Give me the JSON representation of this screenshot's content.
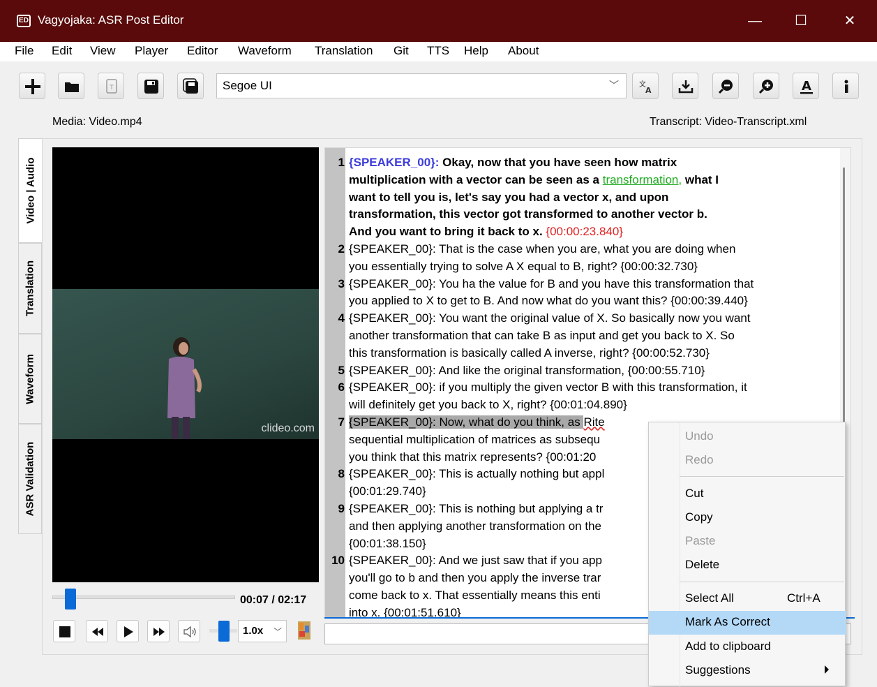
{
  "window": {
    "title": "Vagyojaka: ASR Post Editor",
    "app_icon_text": "ED"
  },
  "menu": [
    "File",
    "Edit",
    "View",
    "Player",
    "Editor",
    "Waveform",
    "Translation",
    "Git",
    "TTS",
    "Help",
    "About"
  ],
  "toolbar": {
    "font": "Segoe UI"
  },
  "labels": {
    "media": "Media: Video.mp4",
    "transcript": "Transcript: Video-Transcript.xml"
  },
  "tabs": [
    "Video | Audio",
    "Translation",
    "Waveform",
    "ASR Validation"
  ],
  "video": {
    "watermark": "clideo.com"
  },
  "player": {
    "time": "00:07 / 02:17",
    "speed": "1.0x",
    "position": 0.05,
    "volume": 0.9
  },
  "transcript": [
    {
      "num": "1",
      "lines": [
        {
          "speaker": "{SPEAKER_00}:",
          "text": " Okay, now that you have seen how matrix"
        },
        {
          "text": "multiplication with a vector can be seen as a ",
          "highlight": "transformation,",
          "after": " what I"
        },
        {
          "text": "want to tell you is, let's say you had a vector x, and upon"
        },
        {
          "text": "transformation, this vector got transformed to another vector b."
        },
        {
          "text": "And you want to bring it back to x. ",
          "ts": "{00:00:23.840}"
        }
      ]
    },
    {
      "num": "2",
      "lines": [
        {
          "text": "{SPEAKER_00}: That is the case when you are, what you are doing when"
        },
        {
          "text": "you essentially trying to solve A X equal to B, right? {00:00:32.730}"
        }
      ]
    },
    {
      "num": "3",
      "lines": [
        {
          "text": "{SPEAKER_00}: You ha the value for B and you have this transformation that"
        },
        {
          "text": "you applied to X to get to B. And now what do you want this? {00:00:39.440}"
        }
      ]
    },
    {
      "num": "4",
      "lines": [
        {
          "text": "{SPEAKER_00}: You want the original value of X. So basically now you want"
        },
        {
          "text": "another transformation that can take B as input and get you back to X. So"
        },
        {
          "text": "this transformation is basically called A inverse, right? {00:00:52.730}"
        }
      ]
    },
    {
      "num": "5",
      "lines": [
        {
          "text": "{SPEAKER_00}: And like the original transformation, {00:00:55.710}"
        }
      ]
    },
    {
      "num": "6",
      "lines": [
        {
          "text": "{SPEAKER_00}: if you multiply the given vector B with this transformation, it"
        },
        {
          "text": "will definitely get you back to X, right? {00:01:04.890}"
        }
      ]
    },
    {
      "num": "7",
      "lines": [
        {
          "sel": "{SPEAKER_00}: Now, what do you think, as ",
          "squiggle": "Rite"
        },
        {
          "text": "sequential multiplication of matrices as subsequ"
        },
        {
          "text": "you think that this matrix represents? {00:01:20"
        }
      ]
    },
    {
      "num": "8",
      "lines": [
        {
          "text": "{SPEAKER_00}: This is actually nothing but appl"
        },
        {
          "text": "{00:01:29.740}"
        }
      ]
    },
    {
      "num": "9",
      "lines": [
        {
          "text": "{SPEAKER_00}: This is nothing but applying a tr"
        },
        {
          "text": "and then applying another transformation on the"
        },
        {
          "text": "{00:01:38.150}"
        }
      ]
    },
    {
      "num": "10",
      "lines": [
        {
          "text": "{SPEAKER_00}: And we just saw that if you app"
        },
        {
          "text": "you'll go to b and then you apply the inverse trar"
        },
        {
          "text": "come back to x. That essentially means this enti"
        },
        {
          "text": "into x. {00:01:51.610}"
        }
      ]
    }
  ],
  "context_menu": {
    "undo": "Undo",
    "redo": "Redo",
    "cut": "Cut",
    "copy": "Copy",
    "paste": "Paste",
    "delete": "Delete",
    "select_all": "Select All",
    "select_all_shortcut": "Ctrl+A",
    "mark_correct": "Mark As Correct",
    "add_clipboard": "Add to clipboard",
    "suggestions": "Suggestions"
  }
}
